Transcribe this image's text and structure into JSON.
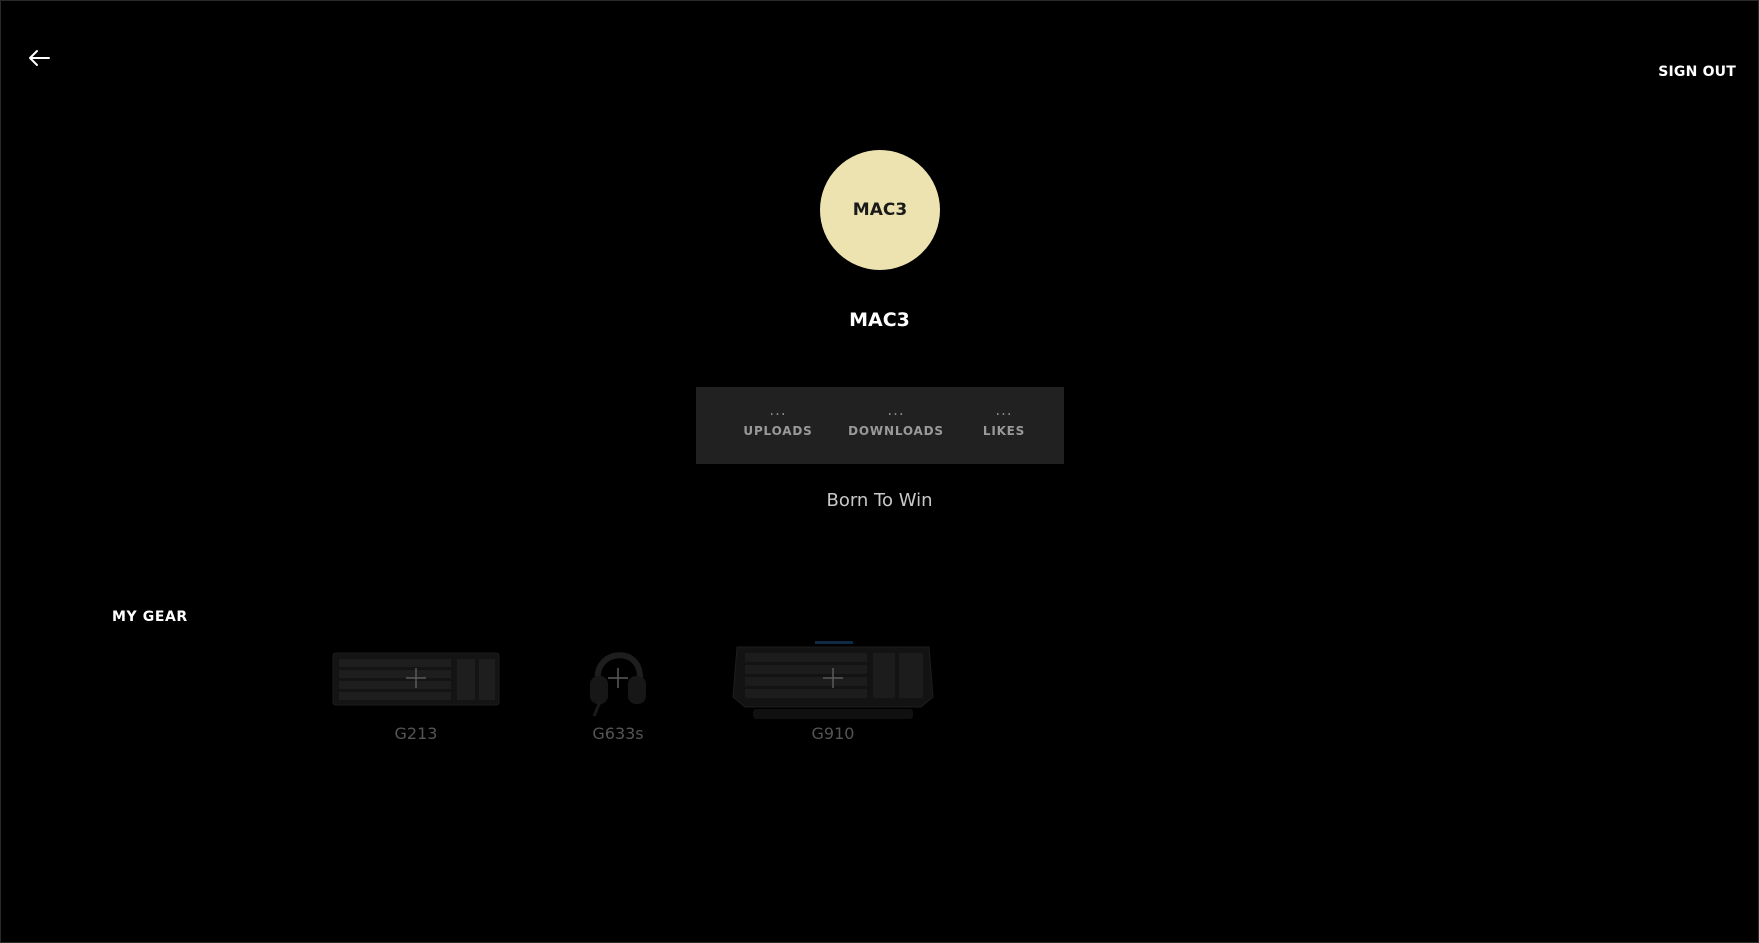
{
  "header": {
    "sign_out_label": "SIGN OUT"
  },
  "profile": {
    "avatar_text": "MAC3",
    "name": "MAC3",
    "motto": "Born To Win",
    "avatar_color": "#ede3b0"
  },
  "stats": [
    {
      "value": "...",
      "label": "UPLOADS"
    },
    {
      "value": "...",
      "label": "DOWNLOADS"
    },
    {
      "value": "...",
      "label": "LIKES"
    }
  ],
  "gear": {
    "heading": "MY GEAR",
    "items": [
      {
        "name": "G213",
        "icon": "keyboard-icon"
      },
      {
        "name": "G633s",
        "icon": "headset-icon"
      },
      {
        "name": "G910",
        "icon": "keyboard-icon"
      }
    ]
  }
}
